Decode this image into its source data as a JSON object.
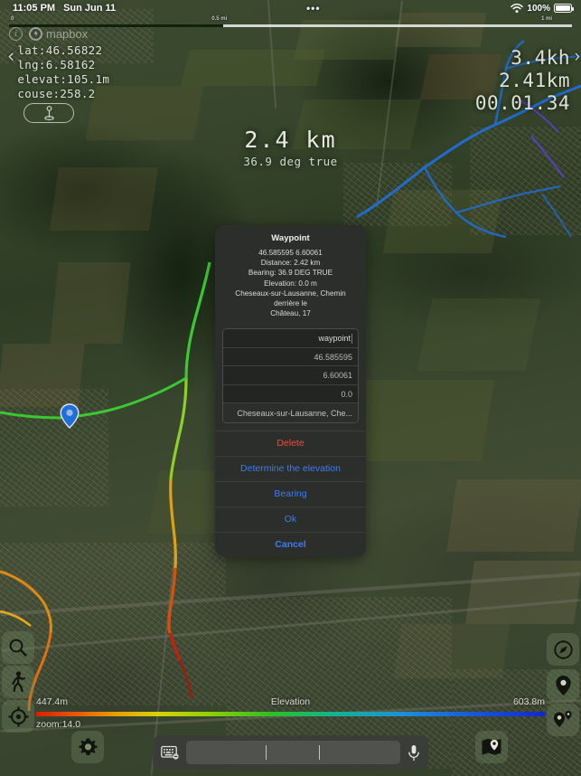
{
  "status_bar": {
    "time": "11:05 PM",
    "date": "Sun Jun 11",
    "dots": "•••",
    "battery_percent": "100%",
    "wifi_icon": "wifi-icon",
    "battery_icon": "battery-full-icon"
  },
  "scale_bar": {
    "left_label": "0",
    "mid_label": "0.5 mi",
    "right_label": "1 mi"
  },
  "attribution": {
    "info_glyph": "i",
    "provider": "mapbox"
  },
  "telemetry": {
    "back_glyph": "‹",
    "lat": "lat:46.56822",
    "lng": "lng:6.58162",
    "elevat": "elevat:105.1m",
    "couse": "couse:258.2",
    "anchor_icon": "waypoint-pin-icon"
  },
  "trip": {
    "speed": "3.4kh",
    "distance": "2.41km",
    "duration": "00.01.34",
    "chevron": "›"
  },
  "center_label": {
    "distance": "2.4  km",
    "bearing": "36.9 deg true"
  },
  "dialog": {
    "title": "Waypoint",
    "coords": "46.585595  6.60061",
    "distance": "Distance: 2.42 km",
    "bearing": "Bearing: 36.9 DEG TRUE",
    "elevation": "Elevation: 0.0 m",
    "address_line1": "Cheseaux-sur-Lausanne, Chemin derrière le",
    "address_line2": "Château, 17",
    "fields": [
      {
        "name": "name-field",
        "value": "waypoint",
        "active": true
      },
      {
        "name": "latitude-field",
        "value": "46.585595",
        "active": false
      },
      {
        "name": "longitude-field",
        "value": "6.60061",
        "active": false
      },
      {
        "name": "elevation-field",
        "value": "0.0",
        "active": false
      },
      {
        "name": "address-field",
        "value": "Cheseaux-sur-Lausanne, Che...",
        "active": false
      }
    ],
    "buttons": [
      {
        "name": "delete-button",
        "label": "Delete",
        "style": "danger"
      },
      {
        "name": "determine-elevation-button",
        "label": "Determine the elevation",
        "style": "link"
      },
      {
        "name": "bearing-button",
        "label": "Bearing",
        "style": "link"
      },
      {
        "name": "ok-button",
        "label": "Ok",
        "style": "link"
      },
      {
        "name": "cancel-button",
        "label": "Cancel",
        "style": "bold"
      }
    ]
  },
  "elevation_bar": {
    "min": "447.4m",
    "label": "Elevation",
    "max": "603.8m",
    "zoom": "zoom:14.0"
  },
  "left_tools": [
    {
      "name": "search-icon",
      "label": "Search"
    },
    {
      "name": "pedestrian-icon",
      "label": "Walking mode"
    },
    {
      "name": "crosshair-icon",
      "label": "Center on position"
    }
  ],
  "right_tools": [
    {
      "name": "compass-icon",
      "label": "Compass"
    },
    {
      "name": "map-pin-icon",
      "label": "Waypoint"
    },
    {
      "name": "multi-pin-icon",
      "label": "Waypoints list"
    }
  ],
  "bottom_tools": [
    {
      "name": "gear-icon",
      "label": "Settings"
    },
    {
      "name": "map-fold-icon",
      "label": "Maps"
    }
  ],
  "input_bar": {
    "keyboard_icon": "keyboard-icon",
    "mic_icon": "microphone-icon",
    "value": "",
    "placeholder": ""
  },
  "colors": {
    "accent_blue": "#3c7cf0",
    "danger_red": "#f04b3c",
    "dialog_bg": "#2c2e2b",
    "track_blue": "#1f6fd8",
    "track_green": "#3cc832",
    "track_orange": "#e08a14",
    "track_red": "#d82a14"
  }
}
